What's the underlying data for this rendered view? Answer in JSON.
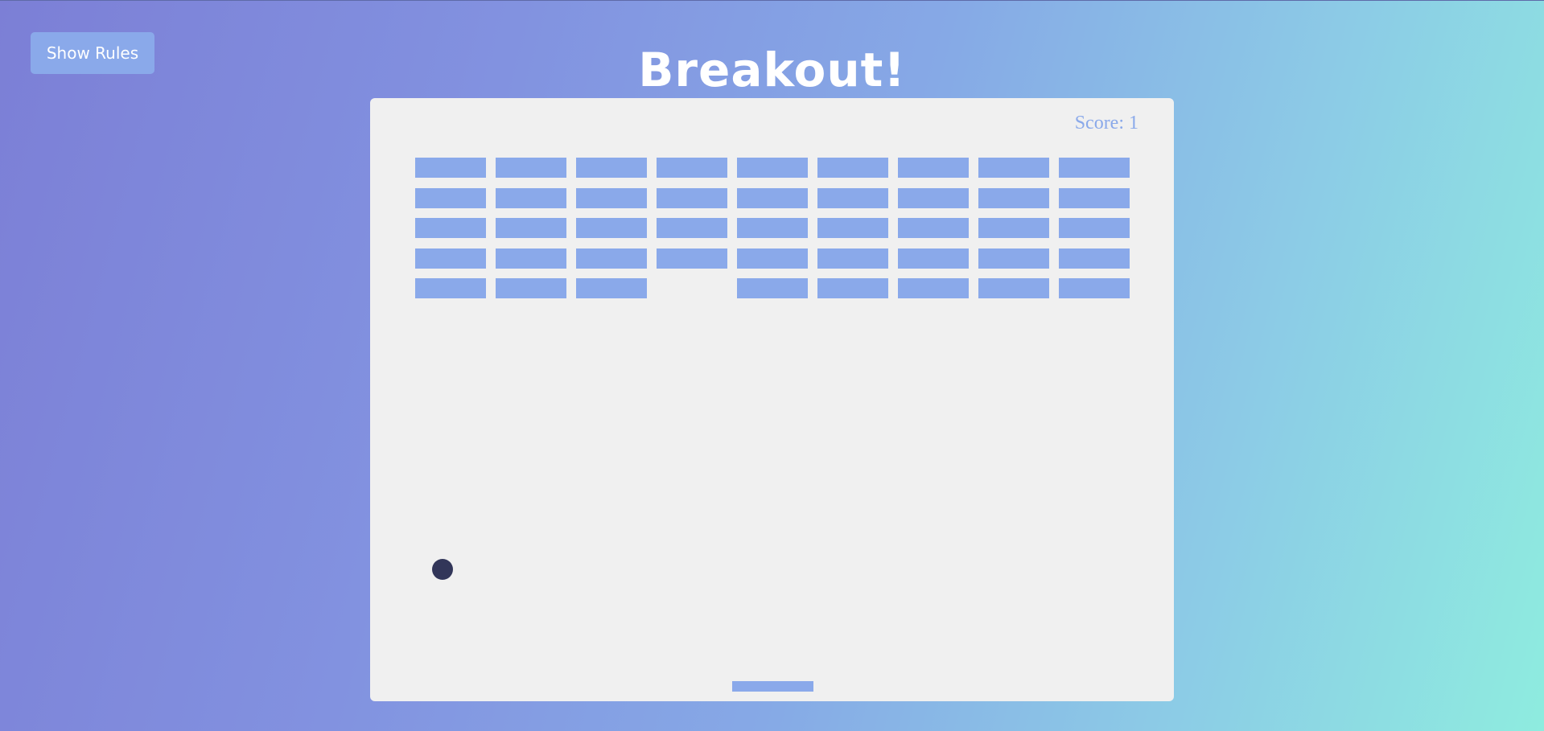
{
  "header": {
    "rules_button_label": "Show Rules",
    "title": "Breakout!"
  },
  "game": {
    "score_label": "Score:",
    "score": "1",
    "brick_grid": {
      "rows": 5,
      "cols": 9,
      "removed": [
        [
          4,
          3
        ]
      ]
    },
    "colors": {
      "background_start": "#7c7fd6",
      "background_end": "#8eecdf",
      "board": "#f0f0f0",
      "brick": "#8aa9ea",
      "paddle": "#8aa9ea",
      "ball": "#323659",
      "score_text": "#8aa9ea"
    }
  }
}
